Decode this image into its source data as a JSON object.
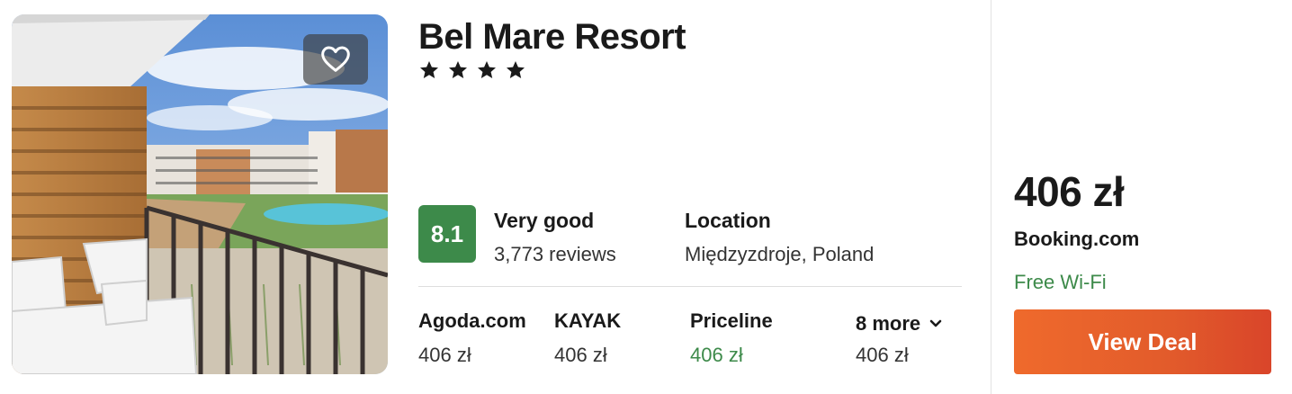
{
  "hotel": {
    "name": "Bel Mare Resort",
    "stars": 4,
    "star_glyph": "★",
    "photo_alt": ""
  },
  "rating": {
    "score": "8.1",
    "label": "Very good",
    "reviews": "3,773 reviews",
    "badge_color": "#3d8a4a"
  },
  "location": {
    "label": "Location",
    "value": "Międzyzdroje, Poland"
  },
  "providers": [
    {
      "name": "Agoda.com",
      "price": "406 zł"
    },
    {
      "name": "KAYAK",
      "price": "406 zł"
    },
    {
      "name": "Priceline",
      "price": "406 zł",
      "highlight": true
    },
    {
      "name": "8 more",
      "price": "406 zł",
      "expandable": true
    }
  ],
  "deal": {
    "price": "406 zł",
    "provider": "Booking.com",
    "amenity": "Free Wi-Fi",
    "button_label": "View Deal",
    "accent_color": "#e25b2b"
  },
  "icons": {
    "favorite": "heart-icon",
    "expand": "chevron-down-icon",
    "star": "star-icon"
  }
}
